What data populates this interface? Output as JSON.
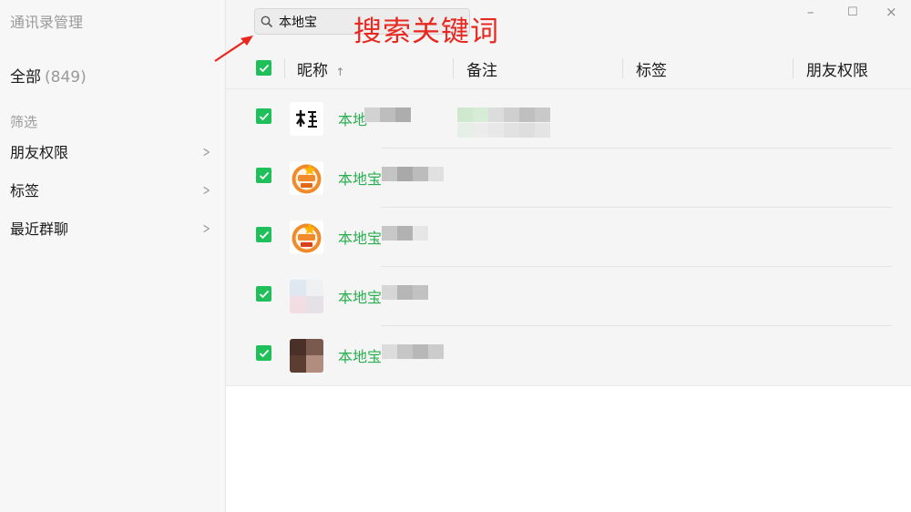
{
  "window": {
    "title": "通讯录管理",
    "minimize_glyph": "–",
    "maximize_glyph": "☐",
    "close_glyph": "×"
  },
  "sidebar": {
    "all_label": "全部",
    "all_count": "(849)",
    "filter_heading": "筛选",
    "items": [
      {
        "label": "朋友权限",
        "chevron": ">"
      },
      {
        "label": "标签",
        "chevron": ">"
      },
      {
        "label": "最近群聊",
        "chevron": ">"
      }
    ]
  },
  "search": {
    "value": "本地宝",
    "icon": "search-icon"
  },
  "annotation": {
    "text": "搜索关键词",
    "color": "#e8281f"
  },
  "table": {
    "columns": [
      {
        "label": "昵称",
        "sort_indicator": "↑"
      },
      {
        "label": "备注"
      },
      {
        "label": "标签"
      },
      {
        "label": "朋友权限"
      }
    ],
    "header_checked": true,
    "rows": [
      {
        "name": "本地",
        "checked": true,
        "avatar": "calligraphy-logo-avatar"
      },
      {
        "name": "本地宝",
        "checked": true,
        "avatar": "orange-badge-avatar"
      },
      {
        "name": "本地宝",
        "checked": true,
        "avatar": "orange-badge-avatar"
      },
      {
        "name": "本地宝",
        "checked": true,
        "avatar": "blurred-photo-avatar"
      },
      {
        "name": "本地宝",
        "checked": true,
        "avatar": "blurred-photo-avatar"
      }
    ]
  },
  "colors": {
    "accent_green": "#1fbf59",
    "name_green": "#2aae4f"
  }
}
